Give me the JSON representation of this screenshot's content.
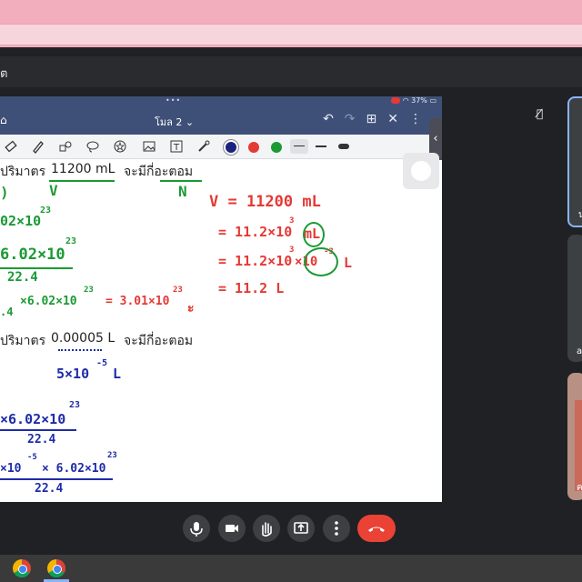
{
  "browser": {
    "meet_title_fragment": "ต"
  },
  "ipad": {
    "status_dots": "•••",
    "battery": "37%",
    "doc_title": "โมล 2 ⌄",
    "header_icons": [
      "undo-icon",
      "redo-icon",
      "add-page-icon",
      "close-icon",
      "more-icon"
    ]
  },
  "toolbar": {
    "tools": [
      "eraser-icon",
      "highlighter-icon",
      "shapes-icon",
      "lasso-icon",
      "sticker-icon",
      "image-icon",
      "text-icon",
      "laser-pointer-icon"
    ],
    "colors": [
      "#1a237e",
      "#e53935",
      "#1b9a34"
    ],
    "stroke_widths": [
      "thin",
      "medium",
      "thick"
    ]
  },
  "notes": {
    "q1_prefix": "ปริมาตร",
    "q1_value": "11200 mL",
    "q1_suffix": "จะมีกี่อะตอม",
    "q1_label_v": "V",
    "q1_label_n": "N",
    "q2_prefix": "ปริมาตร",
    "q2_value": "0.00005 L",
    "q2_suffix": "จะมีกี่อะตอม",
    "hw_green_1": "02×10",
    "hw_green_1_exp": "23",
    "hw_green_2": "6.02×10",
    "hw_green_2_exp": "23",
    "hw_green_3": "22.4",
    "hw_green_4": "×6.02×10",
    "hw_green_4_exp": "23",
    "hw_green_5": ".4",
    "hw_red_result": "= 3.01×10",
    "hw_red_result_exp": "23",
    "hw_red_v": "V = 11200 mL",
    "hw_red_2": "= 11.2×10",
    "hw_red_2_exp": "3",
    "hw_red_2_unit": "mL",
    "hw_red_3": "= 11.2×10",
    "hw_red_3_exp": "3",
    "hw_red_3_mid": "×10",
    "hw_red_3_mid_exp": "-3",
    "hw_red_3_unit": "L",
    "hw_red_4": "= 11.2 L",
    "hw_blue_1": "5×10",
    "hw_blue_1_exp": "-5",
    "hw_blue_1_unit": "L",
    "hw_blue_2": "×6.02×10",
    "hw_blue_2_exp": "23",
    "hw_blue_3": "22.4",
    "hw_blue_4": "×10",
    "hw_blue_4_exp": "-5",
    "hw_blue_4_rest": "× 6.02×10",
    "hw_blue_4_rest_exp": "23",
    "hw_blue_5": "22.4"
  },
  "participants": {
    "tile1_label": "น",
    "tile2_label": "a",
    "tile3_label": "ค"
  },
  "controls": [
    "mic-icon",
    "camera-icon",
    "raise-hand-icon",
    "present-icon",
    "more-options-icon",
    "end-call-icon"
  ],
  "colors": {
    "end_call": "#ea4335",
    "accent": "#8ab4f8",
    "ipad_header": "#3f5078"
  }
}
